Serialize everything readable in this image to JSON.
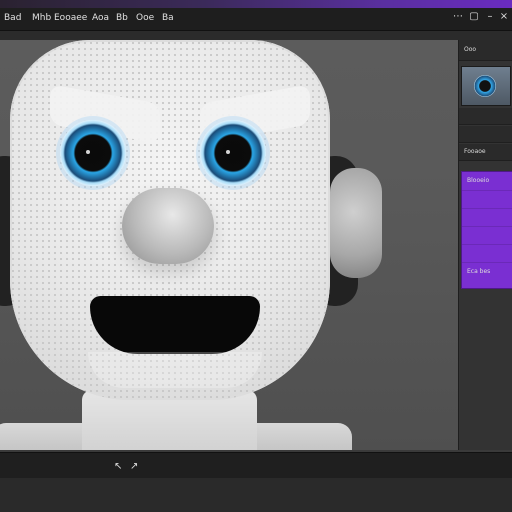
{
  "menubar": {
    "items": [
      "Bad",
      "Mhb",
      "Eooaee",
      "Aoa",
      "Bb",
      "Ooe",
      "Ba"
    ],
    "icons": [
      "dots-icon",
      "window-icon",
      "minimize-icon",
      "close-icon"
    ]
  },
  "right_panel": {
    "header_label": "Ooo",
    "row_label": "Fooaoe",
    "purple_header": "Blooeio",
    "purple_footer": "Eca bes"
  },
  "colors": {
    "accent_purple": "#7a2fd2",
    "eye_blue": "#2aa6e6"
  }
}
